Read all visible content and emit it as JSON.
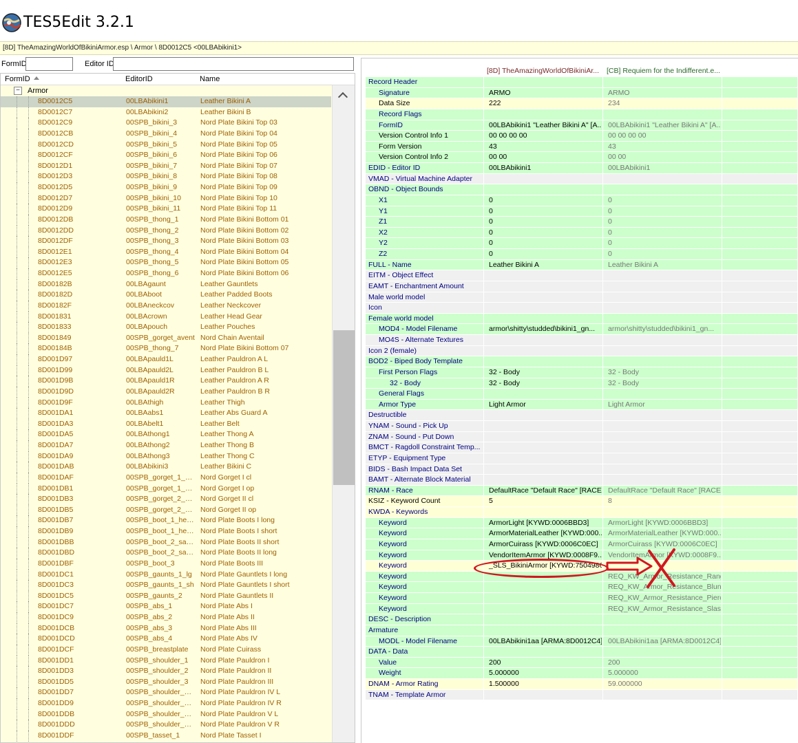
{
  "window": {
    "title": "TES5Edit 3.2.1",
    "icon": "tes5edit-globe-icon"
  },
  "breadcrumb": "[8D] TheAmazingWorldOfBikiniArmor.esp \\ Armor \\ 8D0012C5 <00LBAbikini1>",
  "filter": {
    "formid_label": "FormID",
    "editorid_label": "Editor ID",
    "formid_value": "",
    "editorid_value": ""
  },
  "navigator": {
    "columns": {
      "formid": "FormID",
      "editorid": "EditorID",
      "name": "Name"
    },
    "group_label": "Armor",
    "selected_formid": "8D0012C5",
    "records": [
      {
        "formid": "8D0012C5",
        "editorid": "00LBAbikini1",
        "name": "Leather Bikini A"
      },
      {
        "formid": "8D0012C7",
        "editorid": "00LBAbikini2",
        "name": "Leather Bikini B"
      },
      {
        "formid": "8D0012C9",
        "editorid": "00SPB_bikini_3",
        "name": "Nord Plate Bikini Top 03"
      },
      {
        "formid": "8D0012CB",
        "editorid": "00SPB_bikini_4",
        "name": "Nord Plate Bikini Top 04"
      },
      {
        "formid": "8D0012CD",
        "editorid": "00SPB_bikini_5",
        "name": "Nord Plate Bikini Top 05"
      },
      {
        "formid": "8D0012CF",
        "editorid": "00SPB_bikini_6",
        "name": "Nord Plate Bikini Top 06"
      },
      {
        "formid": "8D0012D1",
        "editorid": "00SPB_bikini_7",
        "name": "Nord Plate Bikini Top 07"
      },
      {
        "formid": "8D0012D3",
        "editorid": "00SPB_bikini_8",
        "name": "Nord Plate Bikini Top 08"
      },
      {
        "formid": "8D0012D5",
        "editorid": "00SPB_bikini_9",
        "name": "Nord Plate Bikini Top 09"
      },
      {
        "formid": "8D0012D7",
        "editorid": "00SPB_bikini_10",
        "name": "Nord Plate Bikini Top 10"
      },
      {
        "formid": "8D0012D9",
        "editorid": "00SPB_bikini_11",
        "name": "Nord Plate Bikini Top 11"
      },
      {
        "formid": "8D0012DB",
        "editorid": "00SPB_thong_1",
        "name": "Nord Plate Bikini Bottom 01"
      },
      {
        "formid": "8D0012DD",
        "editorid": "00SPB_thong_2",
        "name": "Nord Plate Bikini Bottom 02"
      },
      {
        "formid": "8D0012DF",
        "editorid": "00SPB_thong_3",
        "name": "Nord Plate Bikini Bottom 03"
      },
      {
        "formid": "8D0012E1",
        "editorid": "00SPB_thong_4",
        "name": "Nord Plate Bikini Bottom 04"
      },
      {
        "formid": "8D0012E3",
        "editorid": "00SPB_thong_5",
        "name": "Nord Plate Bikini Bottom 05"
      },
      {
        "formid": "8D0012E5",
        "editorid": "00SPB_thong_6",
        "name": "Nord Plate Bikini Bottom 06"
      },
      {
        "formid": "8D00182B",
        "editorid": "00LBAgaunt",
        "name": "Leather Gauntlets"
      },
      {
        "formid": "8D00182D",
        "editorid": "00LBAboot",
        "name": "Leather Padded Boots"
      },
      {
        "formid": "8D00182F",
        "editorid": "00LBAneckcov",
        "name": "Leather Neckcover"
      },
      {
        "formid": "8D001831",
        "editorid": "00LBAcrown",
        "name": "Leather Head Gear"
      },
      {
        "formid": "8D001833",
        "editorid": "00LBApouch",
        "name": "Leather Pouches"
      },
      {
        "formid": "8D001849",
        "editorid": "00SPB_gorget_avent",
        "name": "Nord Chain Aventail"
      },
      {
        "formid": "8D00184B",
        "editorid": "00SPB_thong_7",
        "name": "Nord Plate Bikini Bottom 07"
      },
      {
        "formid": "8D001D97",
        "editorid": "00LBApauld1L",
        "name": "Leather Pauldron A L"
      },
      {
        "formid": "8D001D99",
        "editorid": "00LBApauld2L",
        "name": "Leather Pauldron B L"
      },
      {
        "formid": "8D001D9B",
        "editorid": "00LBApauld1R",
        "name": "Leather Pauldron A R"
      },
      {
        "formid": "8D001D9D",
        "editorid": "00LBApauld2R",
        "name": "Leather Pauldron B R"
      },
      {
        "formid": "8D001D9F",
        "editorid": "00LBAthigh",
        "name": "Leather Thigh"
      },
      {
        "formid": "8D001DA1",
        "editorid": "00LBAabs1",
        "name": "Leather Abs Guard A"
      },
      {
        "formid": "8D001DA3",
        "editorid": "00LBAbelt1",
        "name": "Leather Belt"
      },
      {
        "formid": "8D001DA5",
        "editorid": "00LBAthong1",
        "name": "Leather Thong A"
      },
      {
        "formid": "8D001DA7",
        "editorid": "00LBAthong2",
        "name": "Leather Thong B"
      },
      {
        "formid": "8D001DA9",
        "editorid": "00LBAthong3",
        "name": "Leather Thong C"
      },
      {
        "formid": "8D001DAB",
        "editorid": "00LBAbikini3",
        "name": "Leather Bikini C"
      },
      {
        "formid": "8D001DAF",
        "editorid": "00SPB_gorget_1_cl...",
        "name": "Nord Gorget I cl"
      },
      {
        "formid": "8D001DB1",
        "editorid": "00SPB_gorget_1_op...",
        "name": "Nord Gorget I op"
      },
      {
        "formid": "8D001DB3",
        "editorid": "00SPB_gorget_2_cl...",
        "name": "Nord Gorget II cl"
      },
      {
        "formid": "8D001DB5",
        "editorid": "00SPB_gorget_2_op...",
        "name": "Nord Gorget II op"
      },
      {
        "formid": "8D001DB7",
        "editorid": "00SPB_boot_1_heel...",
        "name": "Nord Plate Boots I long"
      },
      {
        "formid": "8D001DB9",
        "editorid": "00SPB_boot_1_heel...",
        "name": "Nord Plate Boots I short"
      },
      {
        "formid": "8D001DBB",
        "editorid": "00SPB_boot_2_sab_...",
        "name": "Nord Plate Boots II short"
      },
      {
        "formid": "8D001DBD",
        "editorid": "00SPB_boot_2_sab_lg",
        "name": "Nord Plate Boots II long"
      },
      {
        "formid": "8D001DBF",
        "editorid": "00SPB_boot_3",
        "name": "Nord Plate Boots III"
      },
      {
        "formid": "8D001DC1",
        "editorid": "00SPB_gaunts_1_lg",
        "name": "Nord Plate Gauntlets I long"
      },
      {
        "formid": "8D001DC3",
        "editorid": "00SPB_gaunts_1_sh",
        "name": "Nord Plate Gauntlets I short"
      },
      {
        "formid": "8D001DC5",
        "editorid": "00SPB_gaunts_2",
        "name": "Nord Plate Gauntlets II"
      },
      {
        "formid": "8D001DC7",
        "editorid": "00SPB_abs_1",
        "name": "Nord Plate Abs I"
      },
      {
        "formid": "8D001DC9",
        "editorid": "00SPB_abs_2",
        "name": "Nord Plate Abs II"
      },
      {
        "formid": "8D001DCB",
        "editorid": "00SPB_abs_3",
        "name": "Nord Plate Abs III"
      },
      {
        "formid": "8D001DCD",
        "editorid": "00SPB_abs_4",
        "name": "Nord Plate Abs IV"
      },
      {
        "formid": "8D001DCF",
        "editorid": "00SPB_breastplate",
        "name": "Nord Plate Cuirass"
      },
      {
        "formid": "8D001DD1",
        "editorid": "00SPB_shoulder_1",
        "name": "Nord Plate Pauldron I"
      },
      {
        "formid": "8D001DD3",
        "editorid": "00SPB_shoulder_2",
        "name": "Nord Plate Pauldron II"
      },
      {
        "formid": "8D001DD5",
        "editorid": "00SPB_shoulder_3",
        "name": "Nord Plate Pauldron III"
      },
      {
        "formid": "8D001DD7",
        "editorid": "00SPB_shoulder_4_L",
        "name": "Nord Plate Pauldron IV L"
      },
      {
        "formid": "8D001DD9",
        "editorid": "00SPB_shoulder_4_R",
        "name": "Nord Plate Pauldron IV R"
      },
      {
        "formid": "8D001DDB",
        "editorid": "00SPB_shoulder_5_L",
        "name": "Nord Plate Pauldron V L"
      },
      {
        "formid": "8D001DDD",
        "editorid": "00SPB_shoulder_5_R",
        "name": "Nord Plate Pauldron V R"
      },
      {
        "formid": "8D001DDF",
        "editorid": "00SPB_tasset_1",
        "name": "Nord Plate Tasset I"
      }
    ]
  },
  "view": {
    "columns": [
      "",
      "[8D] TheAmazingWorldOfBikiniAr...",
      "[CB] Requiem for the Indifferent.e..."
    ],
    "rows": [
      {
        "label": "Record Header",
        "level": 0,
        "style": "nav",
        "v1": "",
        "v2": ""
      },
      {
        "label": "Signature",
        "level": 1,
        "style": "nav",
        "v1": "ARMO",
        "v2": "ARMO"
      },
      {
        "label": "Data Size",
        "level": 1,
        "style": "plain",
        "v1": "222",
        "v2": "234",
        "state": "conflict"
      },
      {
        "label": "Record Flags",
        "level": 1,
        "style": "nav",
        "v1": "",
        "v2": ""
      },
      {
        "label": "FormID",
        "level": 1,
        "style": "nav",
        "v1": "00LBAbikini1 \"Leather Bikini A\" [A...",
        "v2": "00LBAbikini1 \"Leather Bikini A\" [A..."
      },
      {
        "label": "Version Control Info 1",
        "level": 1,
        "style": "plain",
        "v1": "00 00 00 00",
        "v2": "00 00 00 00"
      },
      {
        "label": "Form Version",
        "level": 1,
        "style": "plain",
        "v1": "43",
        "v2": "43"
      },
      {
        "label": "Version Control Info 2",
        "level": 1,
        "style": "plain",
        "v1": "00 00",
        "v2": "00 00"
      },
      {
        "label": "EDID - Editor ID",
        "level": 0,
        "style": "nav",
        "v1": "00LBAbikini1",
        "v2": "00LBAbikini1"
      },
      {
        "label": "VMAD - Virtual Machine Adapter",
        "level": 0,
        "style": "nav",
        "v1": "",
        "v2": "",
        "state": "disabled"
      },
      {
        "label": "OBND - Object Bounds",
        "level": 0,
        "style": "nav",
        "v1": "",
        "v2": ""
      },
      {
        "label": "X1",
        "level": 1,
        "style": "nav",
        "v1": "0",
        "v2": "0"
      },
      {
        "label": "Y1",
        "level": 1,
        "style": "nav",
        "v1": "0",
        "v2": "0"
      },
      {
        "label": "Z1",
        "level": 1,
        "style": "nav",
        "v1": "0",
        "v2": "0"
      },
      {
        "label": "X2",
        "level": 1,
        "style": "nav",
        "v1": "0",
        "v2": "0"
      },
      {
        "label": "Y2",
        "level": 1,
        "style": "nav",
        "v1": "0",
        "v2": "0"
      },
      {
        "label": "Z2",
        "level": 1,
        "style": "nav",
        "v1": "0",
        "v2": "0"
      },
      {
        "label": "FULL - Name",
        "level": 0,
        "style": "nav",
        "v1": "Leather Bikini A",
        "v2": "Leather Bikini A"
      },
      {
        "label": "EITM - Object Effect",
        "level": 0,
        "style": "nav",
        "v1": "",
        "v2": "",
        "state": "disabled"
      },
      {
        "label": "EAMT - Enchantment Amount",
        "level": 0,
        "style": "nav",
        "v1": "",
        "v2": "",
        "state": "disabled"
      },
      {
        "label": "Male world model",
        "level": 0,
        "style": "nav",
        "v1": "",
        "v2": "",
        "state": "disabled"
      },
      {
        "label": "Icon",
        "level": 0,
        "style": "nav",
        "v1": "",
        "v2": "",
        "state": "disabled"
      },
      {
        "label": "Female world model",
        "level": 0,
        "style": "nav",
        "v1": "",
        "v2": ""
      },
      {
        "label": "MOD4 - Model Filename",
        "level": 1,
        "style": "nav",
        "v1": "armor\\shitty\\studded\\bikini1_gn...",
        "v2": "armor\\shitty\\studded\\bikini1_gn..."
      },
      {
        "label": "MO4S - Alternate Textures",
        "level": 1,
        "style": "nav",
        "v1": "",
        "v2": "",
        "state": "disabled"
      },
      {
        "label": "Icon 2 (female)",
        "level": 0,
        "style": "nav",
        "v1": "",
        "v2": "",
        "state": "disabled"
      },
      {
        "label": "BOD2 - Biped Body Template",
        "level": 0,
        "style": "nav",
        "v1": "",
        "v2": ""
      },
      {
        "label": "First Person Flags",
        "level": 1,
        "style": "nav",
        "v1": "32 - Body",
        "v2": "32 - Body"
      },
      {
        "label": "32 - Body",
        "level": 2,
        "style": "nav",
        "v1": "32 - Body",
        "v2": "32 - Body"
      },
      {
        "label": "General Flags",
        "level": 1,
        "style": "nav",
        "v1": "",
        "v2": ""
      },
      {
        "label": "Armor Type",
        "level": 1,
        "style": "nav",
        "v1": "Light Armor",
        "v2": "Light Armor"
      },
      {
        "label": "Destructible",
        "level": 0,
        "style": "nav",
        "v1": "",
        "v2": "",
        "state": "disabled"
      },
      {
        "label": "YNAM - Sound - Pick Up",
        "level": 0,
        "style": "nav",
        "v1": "",
        "v2": "",
        "state": "disabled"
      },
      {
        "label": "ZNAM - Sound - Put Down",
        "level": 0,
        "style": "nav",
        "v1": "",
        "v2": "",
        "state": "disabled"
      },
      {
        "label": "BMCT - Ragdoll Constraint Temp...",
        "level": 0,
        "style": "nav",
        "v1": "",
        "v2": "",
        "state": "disabled"
      },
      {
        "label": "ETYP - Equipment Type",
        "level": 0,
        "style": "nav",
        "v1": "",
        "v2": "",
        "state": "disabled"
      },
      {
        "label": "BIDS - Bash Impact Data Set",
        "level": 0,
        "style": "nav",
        "v1": "",
        "v2": "",
        "state": "disabled"
      },
      {
        "label": "BAMT - Alternate Block Material",
        "level": 0,
        "style": "nav",
        "v1": "",
        "v2": "",
        "state": "disabled"
      },
      {
        "label": "RNAM - Race",
        "level": 0,
        "style": "nav",
        "v1": "DefaultRace \"Default Race\" [RACE...",
        "v2": "DefaultRace \"Default Race\" [RACE..."
      },
      {
        "label": "KSIZ - Keyword Count",
        "level": 0,
        "style": "plain",
        "v1": "5",
        "v2": "8",
        "state": "conflict"
      },
      {
        "label": "KWDA - Keywords",
        "level": 0,
        "style": "nav",
        "v1": "",
        "v2": "",
        "state": "conflict"
      },
      {
        "label": "Keyword",
        "level": 1,
        "style": "nav",
        "v1": "ArmorLight [KYWD:0006BBD3]",
        "v2": "ArmorLight [KYWD:0006BBD3]"
      },
      {
        "label": "Keyword",
        "level": 1,
        "style": "nav",
        "v1": "ArmorMaterialLeather [KYWD:000...",
        "v2": "ArmorMaterialLeather [KYWD:000..."
      },
      {
        "label": "Keyword",
        "level": 1,
        "style": "nav",
        "v1": "ArmorCuirass [KYWD:0006C0EC]",
        "v2": "ArmorCuirass [KYWD:0006C0EC]"
      },
      {
        "label": "Keyword",
        "level": 1,
        "style": "nav",
        "v1": "VendorItemArmor [KYWD:0008F9...",
        "v2": "VendorItemArmor [KYWD:0008F9..."
      },
      {
        "label": "Keyword",
        "level": 1,
        "style": "nav",
        "v1": "_SLS_BikiniArmor [KYWD:75049867]",
        "v2": "",
        "state": "conflict"
      },
      {
        "label": "Keyword",
        "level": 1,
        "style": "nav",
        "v1": "",
        "v2": "REQ_KW_Armor_Resistance_Rang..."
      },
      {
        "label": "Keyword",
        "level": 1,
        "style": "nav",
        "v1": "",
        "v2": "REQ_KW_Armor_Resistance_Blunt..."
      },
      {
        "label": "Keyword",
        "level": 1,
        "style": "nav",
        "v1": "",
        "v2": "REQ_KW_Armor_Resistance_Pierc..."
      },
      {
        "label": "Keyword",
        "level": 1,
        "style": "nav",
        "v1": "",
        "v2": "REQ_KW_Armor_Resistance_Slash..."
      },
      {
        "label": "DESC - Description",
        "level": 0,
        "style": "nav",
        "v1": "",
        "v2": ""
      },
      {
        "label": "Armature",
        "level": 0,
        "style": "nav",
        "v1": "",
        "v2": ""
      },
      {
        "label": "MODL - Model Filename",
        "level": 1,
        "style": "nav",
        "v1": "00LBAbikini1aa [ARMA:8D0012C4]",
        "v2": "00LBAbikini1aa [ARMA:8D0012C4]"
      },
      {
        "label": "DATA - Data",
        "level": 0,
        "style": "nav",
        "v1": "",
        "v2": ""
      },
      {
        "label": "Value",
        "level": 1,
        "style": "nav",
        "v1": "200",
        "v2": "200"
      },
      {
        "label": "Weight",
        "level": 1,
        "style": "nav",
        "v1": "5.000000",
        "v2": "5.000000"
      },
      {
        "label": "DNAM - Armor Rating",
        "level": 0,
        "style": "nav",
        "v1": "1.500000",
        "v2": "59.000000",
        "state": "conflict"
      },
      {
        "label": "TNAM - Template Armor",
        "level": 0,
        "style": "nav",
        "v1": "",
        "v2": "",
        "state": "disabled"
      }
    ]
  },
  "annotations": {
    "color": "#d0181f",
    "circle": "red-ellipse",
    "arrow": "red-arrow-icon",
    "cross": "red-x-icon"
  }
}
